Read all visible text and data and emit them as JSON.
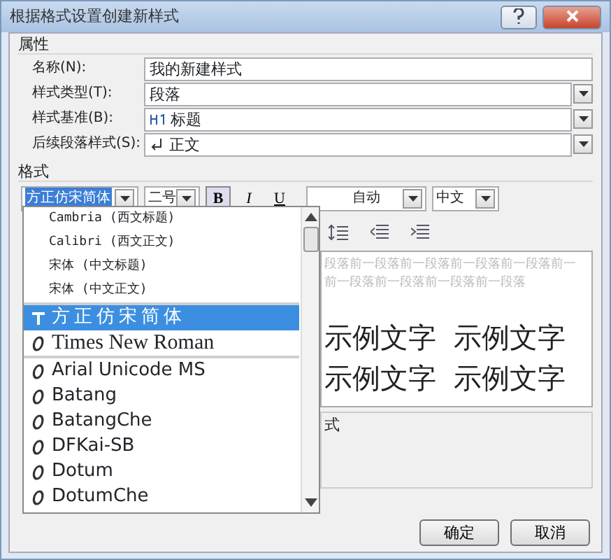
{
  "window": {
    "title": "根据格式设置创建新样式"
  },
  "properties": {
    "heading": "属性",
    "fields": [
      {
        "label": "名称(N):",
        "value": "我的新建样式",
        "kind": "text"
      },
      {
        "label": "样式类型(T):",
        "value": "段落",
        "kind": "combo"
      },
      {
        "label": "样式基准(B):",
        "value": "标题",
        "kind": "heading-style"
      },
      {
        "label": "后续段落样式(S):",
        "value": "正文",
        "kind": "paragraph-style"
      }
    ]
  },
  "format": {
    "heading": "格式",
    "font": "方正仿宋简体",
    "size": "二号",
    "toggles": [
      {
        "label": "B",
        "kind": "bold",
        "pressed": true
      },
      {
        "label": "I",
        "kind": "italic",
        "pressed": false
      },
      {
        "label": "U",
        "kind": "underline",
        "pressed": false
      }
    ],
    "color_setting": "自动",
    "language": "中文"
  },
  "font_dropdown": {
    "groups": [
      {
        "items": [
          {
            "name": "Cambria (西文标题)",
            "kind": "theme",
            "selected": false
          },
          {
            "name": "Calibri (西文正文)",
            "kind": "theme",
            "selected": false
          },
          {
            "name": "宋体 (中文标题)",
            "kind": "theme",
            "selected": false
          },
          {
            "name": "宋体 (中文正文)",
            "kind": "theme",
            "selected": false
          }
        ]
      },
      {
        "items": [
          {
            "name": "方正仿宋简体",
            "kind": "truetype",
            "selected": true
          },
          {
            "name": "Times New Roman",
            "kind": "opentype",
            "selected": false
          }
        ]
      },
      {
        "items": [
          {
            "name": "Arial Unicode MS",
            "kind": "opentype",
            "selected": false
          },
          {
            "name": "Batang",
            "kind": "opentype",
            "selected": false
          },
          {
            "name": "BatangChe",
            "kind": "opentype",
            "selected": false
          },
          {
            "name": "DFKai-SB",
            "kind": "opentype",
            "selected": false
          },
          {
            "name": "Dotum",
            "kind": "opentype",
            "selected": false
          },
          {
            "name": "DotumChe",
            "kind": "opentype",
            "selected": false
          }
        ]
      }
    ]
  },
  "preview": {
    "before_lines": [
      "段落前一段落前一段落前一段落前一段落前一",
      "前一段落前一段落前一段落前一段落"
    ],
    "sample_lines": [
      "示例文字  示例文字",
      "示例文字  示例文字"
    ]
  },
  "description": "式",
  "buttons": [
    "确定",
    "取消"
  ]
}
